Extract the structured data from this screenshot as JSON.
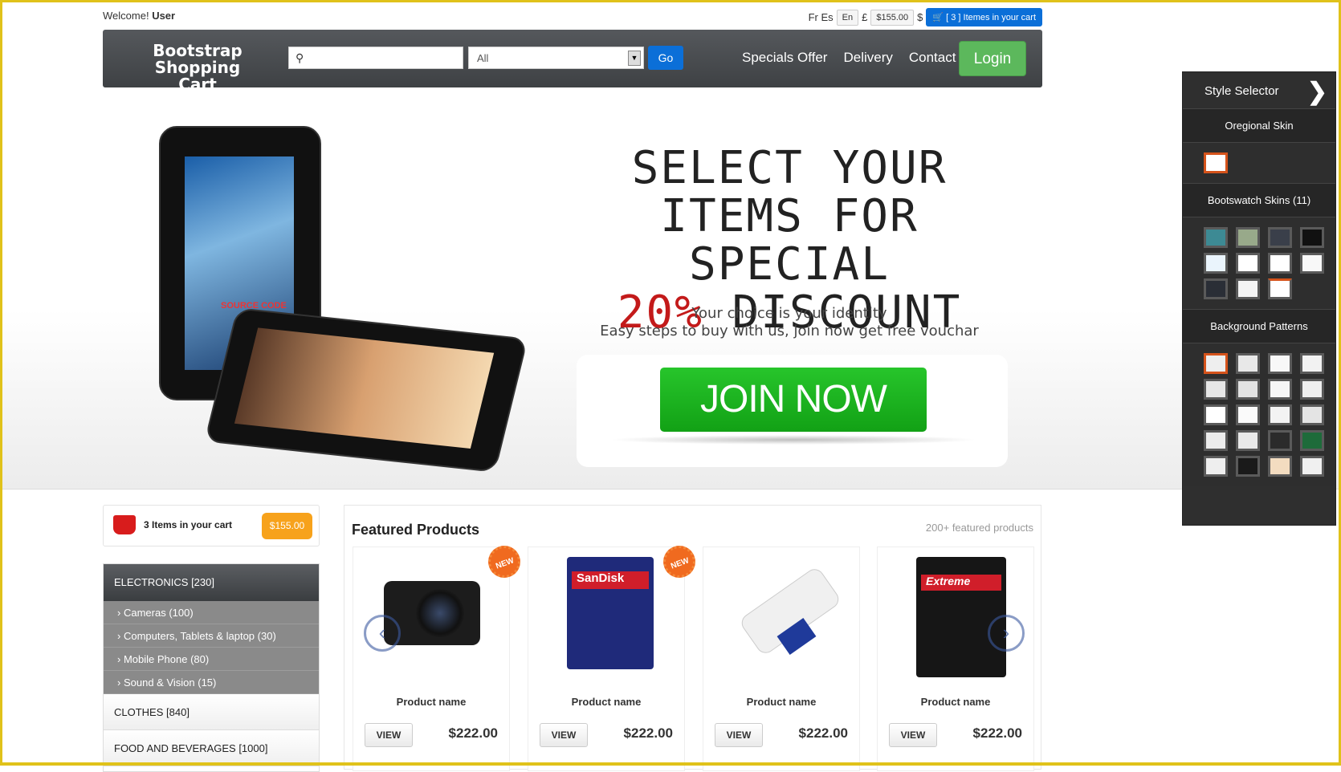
{
  "topbar": {
    "welcome": "Welcome!",
    "user": "User",
    "langs": "Fr Es",
    "lang_active": "En",
    "currency_gbp": "£",
    "cart_total": "$155.00",
    "currency_usd": "$",
    "cart_button": "[ 3 ] Itemes in your cart"
  },
  "navbar": {
    "brand_line1": "Bootstrap",
    "brand_line2": "Shopping Cart",
    "search_placeholder": "",
    "category_select": "All",
    "go": "Go",
    "links": [
      "Specials Offer",
      "Delivery",
      "Contact"
    ],
    "login": "Login"
  },
  "hero": {
    "line1": "SELECT YOUR",
    "line2": "ITEMS FOR SPECIAL",
    "discount": "20%",
    "line3_rest": " DISCOUNT",
    "sub1": "Your choice is your identity",
    "sub2": "Easy steps to buy with us, join now get free vouchar",
    "join": "JOIN NOW",
    "tablet_text": "SOURCE CODE"
  },
  "style_selector": {
    "title": "Style Selector",
    "original": "Oregional Skin",
    "bootswatch": "Bootswatch Skins (11)",
    "patterns": "Background Patterns"
  },
  "cart": {
    "text": "3 Items in your cart",
    "total": "$155.00"
  },
  "categories": {
    "head": "ELECTRONICS [230]",
    "subs": [
      "Cameras (100)",
      "Computers, Tablets & laptop (30)",
      "Mobile Phone (80)",
      "Sound & Vision (15)"
    ],
    "others": [
      "CLOTHES [840]",
      "FOOD AND BEVERAGES [1000]"
    ]
  },
  "featured": {
    "title": "Featured Products",
    "count": "200+ featured products",
    "badge": "NEW",
    "products": [
      {
        "name": "Product name",
        "view": "VIEW",
        "price": "$222.00"
      },
      {
        "name": "Product name",
        "view": "VIEW",
        "price": "$222.00"
      },
      {
        "name": "Product name",
        "view": "VIEW",
        "price": "$222.00"
      },
      {
        "name": "Product name",
        "view": "VIEW",
        "price": "$222.00"
      }
    ]
  }
}
